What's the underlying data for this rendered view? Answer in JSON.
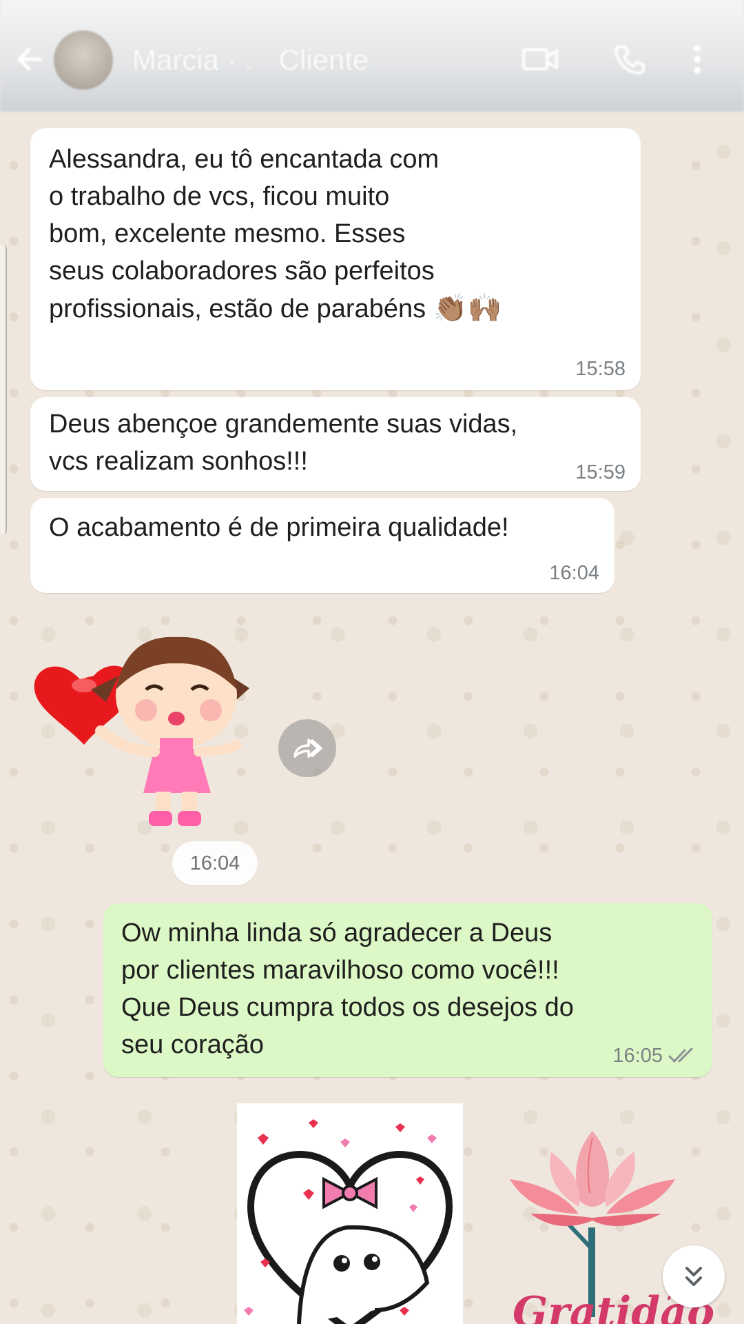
{
  "header": {
    "contact_name": "Marcia · ☄ Cliente",
    "icons": [
      "back-arrow-icon",
      "avatar",
      "video-call-icon",
      "phone-icon",
      "more-vert-icon"
    ]
  },
  "messages": [
    {
      "direction": "incoming",
      "text": "Alessandra, eu tô encantada com\no trabalho de vcs, ficou muito\nbom, excelente mesmo. Esses\nseus colaboradores são perfeitos\nprofissionais, estão de parabéns",
      "emoji": "👏🏽🙌🏽",
      "time": "15:58"
    },
    {
      "direction": "incoming",
      "text": "Deus abençoe grandemente suas vidas,\nvcs realizam sonhos!!!",
      "time": "15:59"
    },
    {
      "direction": "incoming",
      "text": "O acabamento é de primeira qualidade!",
      "time": "16:04"
    },
    {
      "direction": "incoming",
      "type": "sticker",
      "sticker": "girl-blowing-kiss-with-heart",
      "time": "16:04"
    },
    {
      "direction": "outgoing",
      "text": "Ow minha linda  só agradecer a Deus\npor clientes maravilhoso como você!!!\nQue Deus cumpra todos os desejos do\nseu coração",
      "time": "16:05",
      "status": "read-double-check-icon"
    },
    {
      "direction": "outgoing",
      "type": "sticker",
      "sticker": "flork-with-bow-and-hearts"
    },
    {
      "direction": "outgoing",
      "type": "sticker",
      "sticker": "pink-lotus-flower",
      "caption": "Gratidão"
    }
  ],
  "colors": {
    "outgoing_bubble": "#dcf8c6",
    "incoming_bubble": "#ffffff",
    "wallpaper": "#efe7dd",
    "time_text": "#7a7f83"
  }
}
